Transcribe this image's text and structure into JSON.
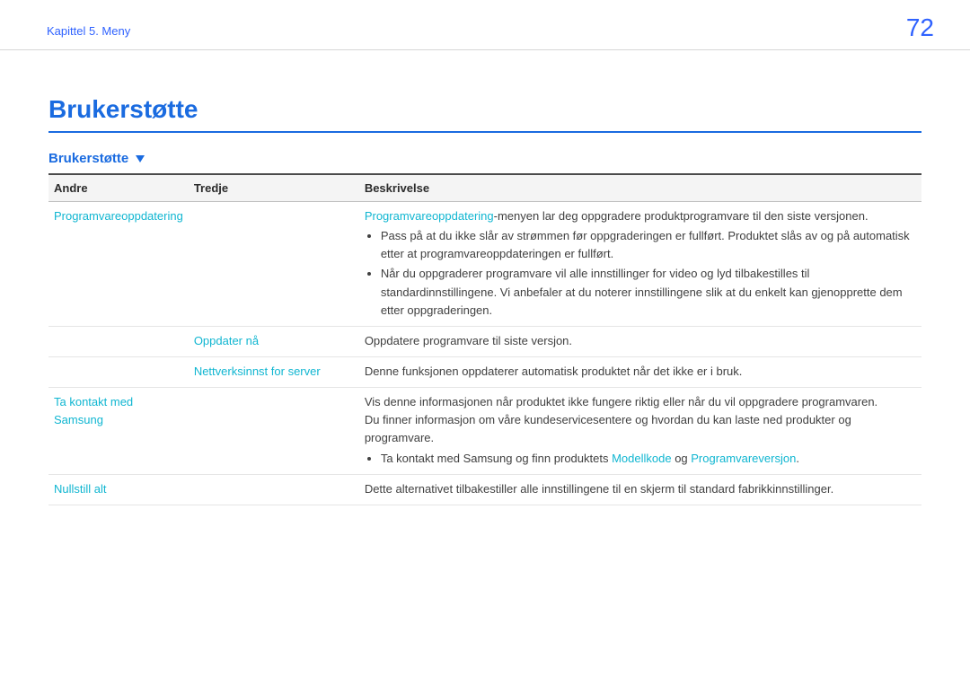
{
  "header": {
    "breadcrumb": "Kapittel 5. Meny",
    "page_number": "72"
  },
  "section": {
    "title": "Brukerstøtte",
    "subsection": "Brukerstøtte"
  },
  "table": {
    "headers": {
      "andre": "Andre",
      "tredje": "Tredje",
      "beskrivelse": "Beskrivelse"
    }
  },
  "rows": {
    "r1": {
      "andre": "Programvareoppdatering",
      "desc_intro_link": "Programvareoppdatering",
      "desc_intro_rest": "-menyen lar deg oppgradere produktprogramvare til den siste versjonen.",
      "bullet1": "Pass på at du ikke slår av strømmen før oppgraderingen er fullført. Produktet slås av og på automatisk etter at programvareoppdateringen er fullført.",
      "bullet2": "Når du oppgraderer programvare vil alle innstillinger for video og lyd tilbakestilles til standardinnstillingene. Vi anbefaler at du noterer innstillingene slik at du enkelt kan gjenopprette dem etter oppgraderingen."
    },
    "r2": {
      "tredje": "Oppdater nå",
      "desc": "Oppdatere programvare til siste versjon."
    },
    "r3": {
      "tredje": "Nettverksinnst for server",
      "desc": "Denne funksjonen oppdaterer automatisk produktet når det ikke er i bruk."
    },
    "r4": {
      "andre": "Ta kontakt med Samsung",
      "line1": "Vis denne informasjonen når produktet ikke fungere riktig eller når du vil oppgradere programvaren.",
      "line2": "Du finner informasjon om våre kundeservicesentere og hvordan du kan laste ned produkter og programvare.",
      "bullet_pre": "Ta kontakt med Samsung og finn produktets ",
      "bullet_link1": "Modellkode",
      "bullet_mid": " og ",
      "bullet_link2": "Programvareversjon",
      "bullet_end": "."
    },
    "r5": {
      "andre": "Nullstill alt",
      "desc": "Dette alternativet tilbakestiller alle innstillingene til en skjerm til standard fabrikkinnstillinger."
    }
  }
}
